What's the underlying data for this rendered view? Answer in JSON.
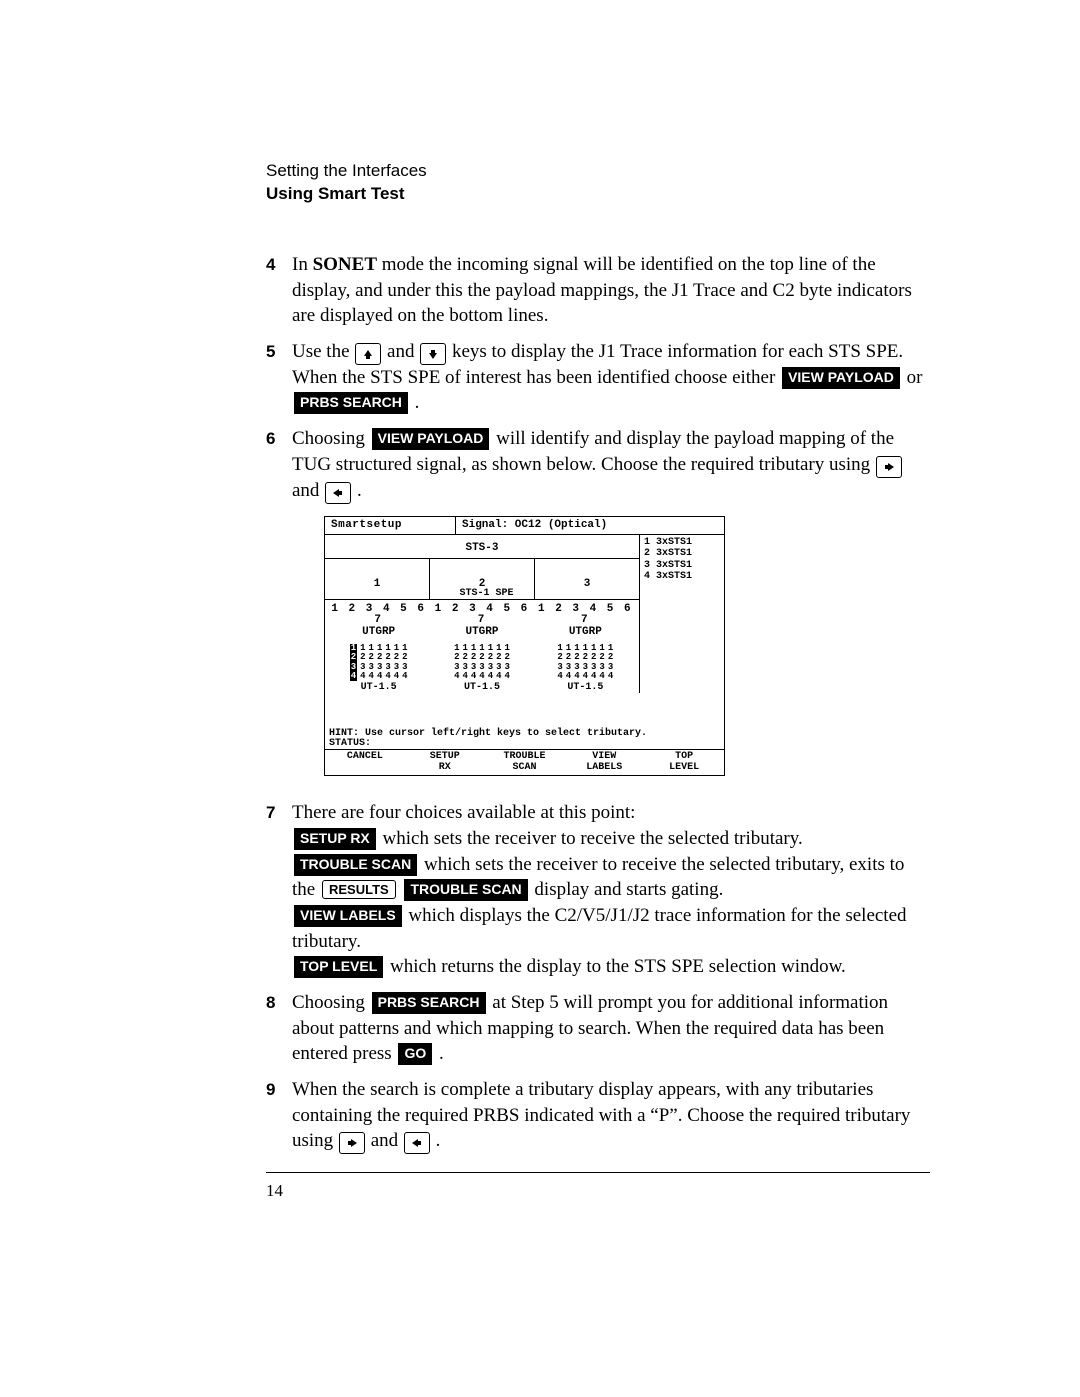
{
  "header": {
    "line1": "Setting the Interfaces",
    "line2": "Using Smart Test"
  },
  "steps": {
    "s4": {
      "num": "4",
      "pre": "In ",
      "mode": "SONET",
      "rest": " mode the incoming signal will be identified on the top line of the display, and under this the payload mappings, the J1 Trace and C2 byte indicators are displayed on the bottom lines."
    },
    "s5": {
      "num": "5",
      "pre": "Use the ",
      "mid1": " and ",
      "mid2": " keys to display the J1 Trace information for each STS SPE. When the STS SPE of interest has been identified choose either ",
      "btn1": "VIEW PAYLOAD",
      "or_txt": " or ",
      "btn2": "PRBS SEARCH",
      "tail": " ."
    },
    "s6": {
      "num": "6",
      "pre": "Choosing ",
      "btn1": "VIEW PAYLOAD",
      "mid": " will identify and display the payload mapping of the TUG structured signal, as shown below. Choose the required tributary using ",
      "and_txt": " and ",
      "tail": "."
    },
    "s7": {
      "num": "7",
      "intro": "There are four choices available at this point:",
      "a_btn": "SETUP RX",
      "a_txt": " which sets the receiver to receive the selected tributary.",
      "b_btn": "TROUBLE SCAN",
      "b_txt": " which sets the receiver to receive the selected tributary, exits to the ",
      "b_key": "RESULTS",
      "b_btn2": "TROUBLE SCAN",
      "b_tail": " display and starts gating.",
      "c_btn": "VIEW LABELS",
      "c_txt": " which displays the C2/V5/J1/J2 trace information for the selected tributary.",
      "d_btn": "TOP LEVEL",
      "d_txt": " which returns the display to the STS SPE selection window."
    },
    "s8": {
      "num": "8",
      "pre": "Choosing ",
      "btn1": "PRBS SEARCH",
      "mid": " at Step 5 will prompt you for additional information about patterns and which mapping to search. When the required data has been entered press ",
      "btn2": "GO",
      "tail": " ."
    },
    "s9": {
      "num": "9",
      "pre": "When the search is complete a tributary display appears, with any tributaries containing the required PRBS indicated with a “P”. Choose the required tributary using ",
      "and_txt": " and ",
      "tail": "."
    }
  },
  "screenshot": {
    "title_left": "Smartsetup",
    "title_right": "Signal: OC12 (Optical)",
    "sts3": "STS-3",
    "spe_label": "STS-1 SPE",
    "sts1": [
      "1",
      "2",
      "3"
    ],
    "legend": "1 3xSTS1\n2 3xSTS1\n3 3xSTS1\n4 3xSTS1",
    "nums": "1 2 3 4 5 6 7",
    "utgrp": "UTGRP",
    "col": "1\n2\n3\n4",
    "ut15": "UT-1.5",
    "hint": "HINT: Use cursor left/right keys to select tributary.",
    "status": "STATUS:",
    "softkeys": [
      "CANCEL",
      "SETUP\nRX",
      "TROUBLE\nSCAN",
      "VIEW\nLABELS",
      "TOP\nLEVEL"
    ]
  },
  "footer": {
    "pagenum": "14"
  }
}
